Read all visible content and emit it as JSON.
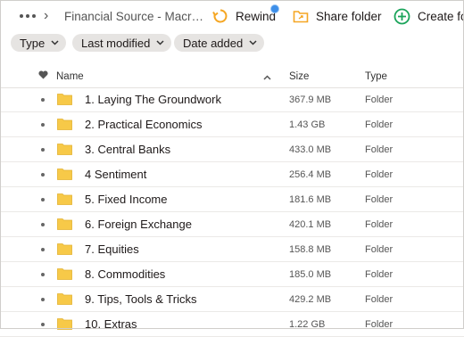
{
  "toolbar": {
    "crumb": "Financial Source - Macr…",
    "rewind_label": "Rewind",
    "share_label": "Share folder",
    "create_label": "Create fo"
  },
  "filters": {
    "type": "Type",
    "modified": "Last modified",
    "added": "Date added"
  },
  "columns": {
    "name": "Name",
    "size": "Size",
    "type": "Type"
  },
  "rows": [
    {
      "name": "1. Laying The Groundwork",
      "size": "367.9 MB",
      "type": "Folder"
    },
    {
      "name": "2. Practical Economics",
      "size": "1.43 GB",
      "type": "Folder"
    },
    {
      "name": "3. Central Banks",
      "size": "433.0 MB",
      "type": "Folder"
    },
    {
      "name": "4 Sentiment",
      "size": "256.4 MB",
      "type": "Folder"
    },
    {
      "name": "5. Fixed Income",
      "size": "181.6 MB",
      "type": "Folder"
    },
    {
      "name": "6. Foreign Exchange",
      "size": "420.1 MB",
      "type": "Folder"
    },
    {
      "name": "7. Equities",
      "size": "158.8 MB",
      "type": "Folder"
    },
    {
      "name": "8. Commodities",
      "size": "185.0 MB",
      "type": "Folder"
    },
    {
      "name": "9. Tips, Tools & Tricks",
      "size": "429.2 MB",
      "type": "Folder"
    },
    {
      "name": "10. Extras",
      "size": "1.22 GB",
      "type": "Folder"
    }
  ],
  "colors": {
    "accent_orange": "#f5a623",
    "accent_green": "#1aa45a",
    "folder": "#f7c948",
    "badge": "#3d8ee8"
  }
}
